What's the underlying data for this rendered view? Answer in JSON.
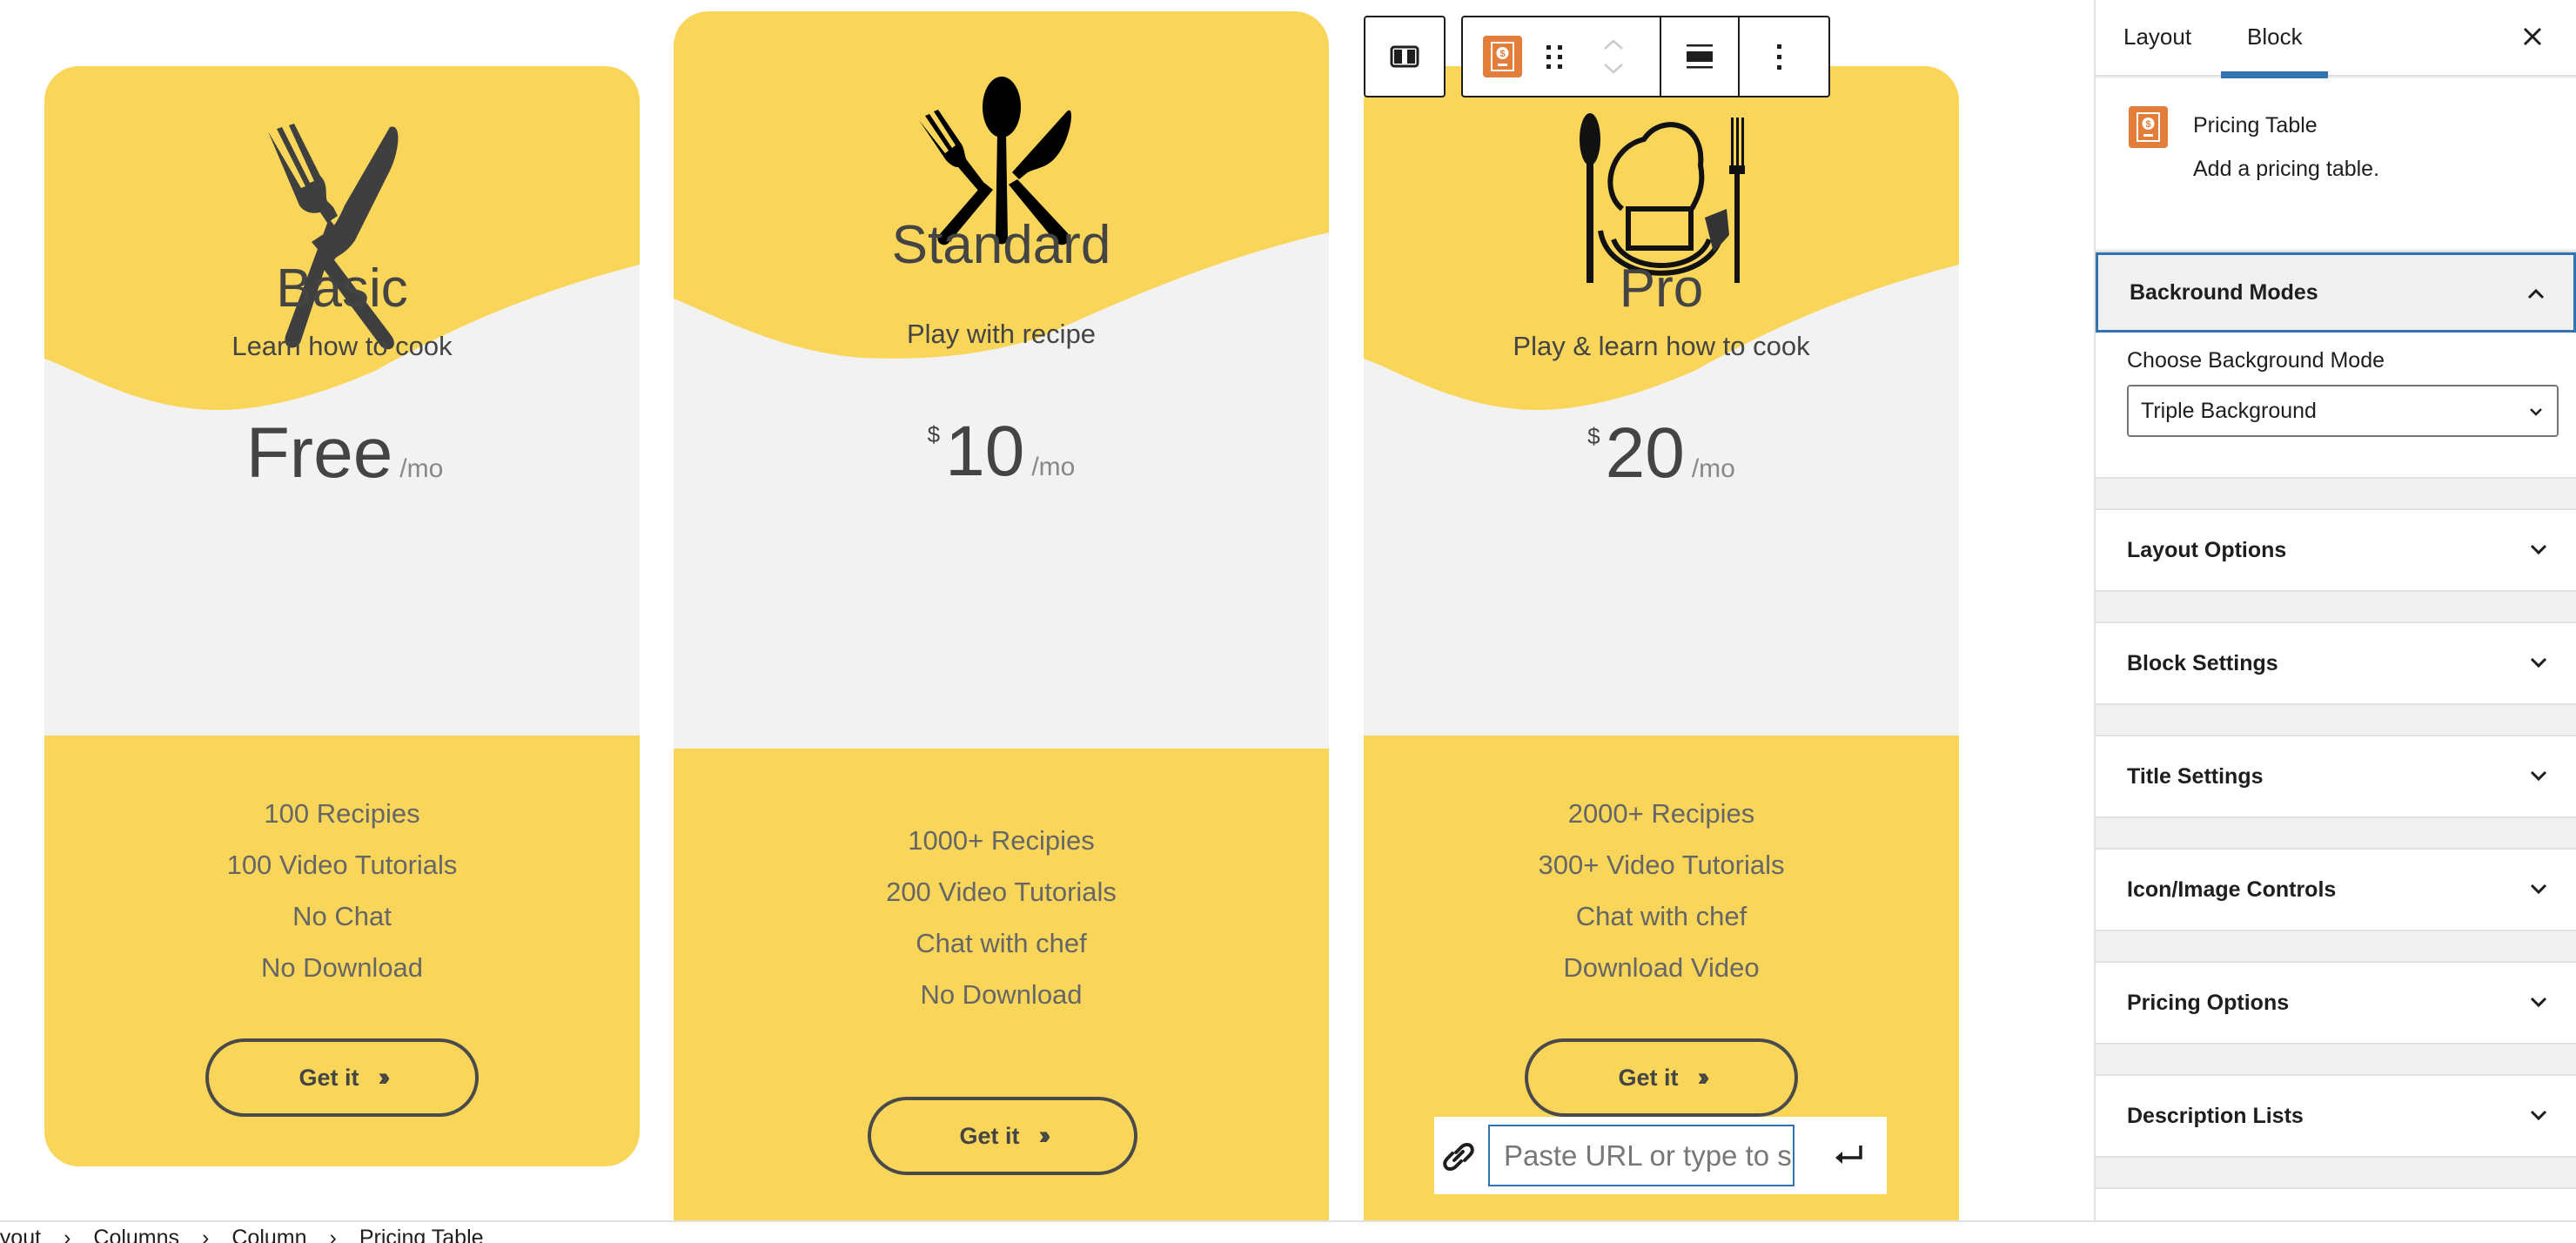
{
  "colors": {
    "card_yellow": "#F9D65A",
    "card_gray": "#F2F2F2",
    "accent_blue": "#3373b2",
    "block_icon_orange": "#E27D3A"
  },
  "plans": [
    {
      "icon": "fork-knife-crossed-icon",
      "title": "Basic",
      "subtitle": "Learn how to cook",
      "currency": "",
      "amount": "Free",
      "period": "/mo",
      "features": [
        "100 Recipies",
        "100 Video Tutorials",
        "No Chat",
        "No Download"
      ],
      "button_label": "Get it",
      "button_icon": "double-chevron-right-icon"
    },
    {
      "icon": "fork-spoon-knife-icon",
      "title": "Standard",
      "subtitle": "Play with recipe",
      "currency": "$",
      "amount": "10",
      "period": "/mo",
      "features": [
        "1000+ Recipies",
        "200 Video Tutorials",
        "Chat with chef",
        "No Download"
      ],
      "button_label": "Get it",
      "button_icon": "double-chevron-right-icon"
    },
    {
      "icon": "chef-hat-utensils-icon",
      "title": "Pro",
      "subtitle": "Play & learn how to cook",
      "currency": "$",
      "amount": "20",
      "period": "/mo",
      "features": [
        "2000+ Recipies",
        "300+ Video Tutorials",
        "Chat with chef",
        "Download Video"
      ],
      "button_label": "Get it",
      "button_icon": "double-chevron-right-icon"
    }
  ],
  "block_toolbar": {
    "items": [
      "select-parent-columns",
      "pricing-table-block-type",
      "drag-handle",
      "move-up",
      "move-down",
      "align",
      "more-options"
    ]
  },
  "link_popover": {
    "placeholder": "Paste URL or type to search",
    "submit_icon": "enter-icon"
  },
  "sidebar": {
    "tabs": [
      {
        "label": "Layout",
        "active": false
      },
      {
        "label": "Block",
        "active": true
      }
    ],
    "block": {
      "name": "Pricing Table",
      "description": "Add a pricing table."
    },
    "panels": [
      {
        "title": "Backround Modes",
        "open": true,
        "field_label": "Choose Background Mode",
        "selected": "Triple Background"
      },
      {
        "title": "Layout Options",
        "open": false
      },
      {
        "title": "Block Settings",
        "open": false
      },
      {
        "title": "Title Settings",
        "open": false
      },
      {
        "title": "Icon/Image Controls",
        "open": false
      },
      {
        "title": "Pricing Options",
        "open": false
      },
      {
        "title": "Description Lists",
        "open": false
      }
    ]
  },
  "breadcrumb": [
    "Layout",
    "Columns",
    "Column",
    "Pricing Table"
  ]
}
